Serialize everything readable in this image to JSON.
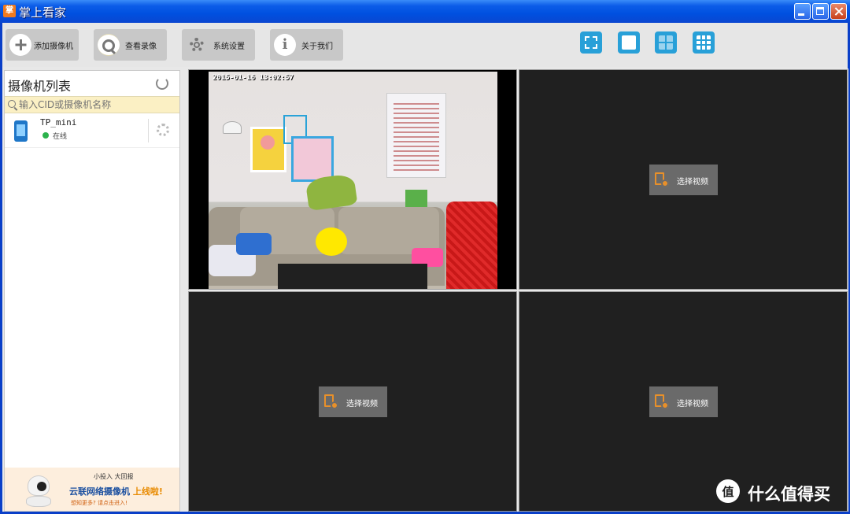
{
  "window": {
    "title": "掌上看家",
    "app_icon_label": "掌",
    "controls": [
      "minimize",
      "maximize",
      "close"
    ]
  },
  "toolbar": {
    "buttons": [
      {
        "label": "添加摄像机",
        "icon": "add-icon"
      },
      {
        "label": "查看录像",
        "icon": "search-icon"
      },
      {
        "label": "系统设置",
        "icon": "gear-icon"
      },
      {
        "label": "关于我们",
        "icon": "info-icon"
      }
    ],
    "layout_buttons": [
      "fullscreen-icon",
      "single-view-icon",
      "quad-view-icon",
      "nine-view-icon"
    ]
  },
  "sidebar": {
    "title": "摄像机列表",
    "search_placeholder": "输入CID或摄像机名称",
    "cameras": [
      {
        "name": "TP_mini",
        "status": "在线",
        "status_color": "#2bb24c"
      }
    ],
    "ad": {
      "line1": "小投入 大回报",
      "line2": "云联网络摄像机",
      "line2_highlight": "上线啦!",
      "line3": "想知更多? 请点击进入!"
    }
  },
  "video_grid": {
    "panes": [
      {
        "timestamp": "2015-01-16 13:02:57",
        "has_video": true
      },
      {
        "select_label": "选择视频",
        "has_video": false
      },
      {
        "select_label": "选择视频",
        "has_video": false
      },
      {
        "select_label": "选择视频",
        "has_video": false
      }
    ]
  },
  "watermark": {
    "text": "什么值得买",
    "logo": "值"
  }
}
